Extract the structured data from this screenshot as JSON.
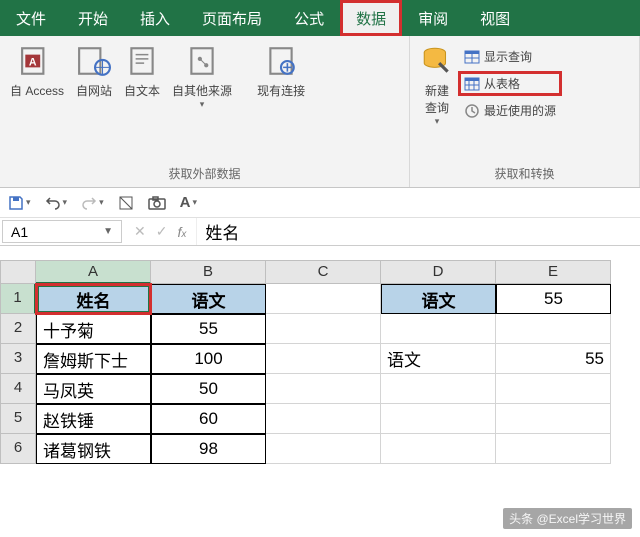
{
  "menu": {
    "items": [
      "文件",
      "开始",
      "插入",
      "页面布局",
      "公式",
      "数据",
      "审阅",
      "视图"
    ],
    "active": 5
  },
  "ribbon": {
    "group1": {
      "label": "获取外部数据",
      "btns": [
        "自 Access",
        "自网站",
        "自文本",
        "自其他来源",
        "现有连接"
      ]
    },
    "group2": {
      "label": "获取和转换",
      "newQuery": "新建\n查询",
      "showQueries": "显示查询",
      "fromTable": "从表格",
      "recentSources": "最近使用的源"
    }
  },
  "formula": {
    "nameBox": "A1",
    "value": "姓名"
  },
  "columns": [
    "A",
    "B",
    "C",
    "D",
    "E"
  ],
  "rows": [
    {
      "n": "1",
      "A": "姓名",
      "B": "语文",
      "C": "",
      "D": "语文",
      "E": "55"
    },
    {
      "n": "2",
      "A": "十予菊",
      "B": "55",
      "C": "",
      "D": "",
      "E": ""
    },
    {
      "n": "3",
      "A": "詹姆斯下士",
      "B": "100",
      "C": "",
      "D": "语文",
      "E": "55"
    },
    {
      "n": "4",
      "A": "马凤英",
      "B": "50",
      "C": "",
      "D": "",
      "E": ""
    },
    {
      "n": "5",
      "A": "赵铁锤",
      "B": "60",
      "C": "",
      "D": "",
      "E": ""
    },
    {
      "n": "6",
      "A": "诸葛钢铁",
      "B": "98",
      "C": "",
      "D": "",
      "E": ""
    }
  ],
  "watermark": "头条 @Excel学习世界"
}
